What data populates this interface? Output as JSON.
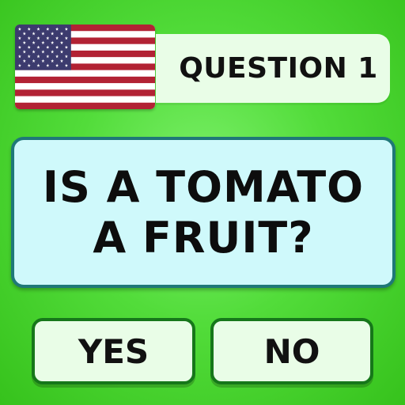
{
  "header": {
    "flag_icon": "us-flag-icon",
    "question_label": "QUESTION 1"
  },
  "question": {
    "line1": "IS A TOMATO",
    "line2": "A FRUIT?"
  },
  "answers": [
    {
      "label": "YES"
    },
    {
      "label": "NO"
    }
  ],
  "colors": {
    "background": "#52dc3a",
    "card_fill": "#cff9fb",
    "card_border": "#1f7878",
    "button_fill": "#e9fde7",
    "button_border": "#16771a",
    "flag_red": "#b22234",
    "flag_blue": "#3c3b6e"
  }
}
